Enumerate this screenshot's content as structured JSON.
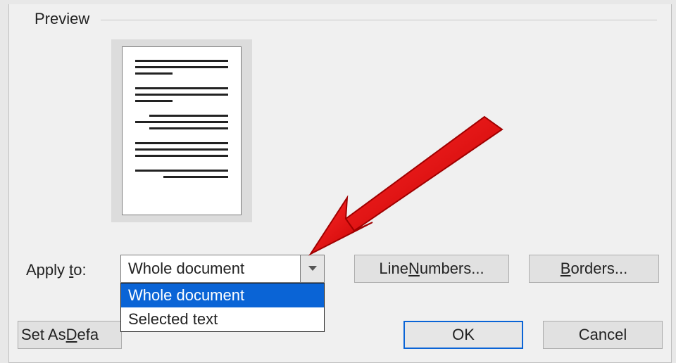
{
  "preview": {
    "group_label": "Preview"
  },
  "apply_to": {
    "label_prefix": "Apply ",
    "label_underlined": "t",
    "label_suffix": "o:",
    "selected": "Whole document",
    "options": [
      "Whole document",
      "Selected text"
    ]
  },
  "buttons": {
    "line_numbers_prefix": "Line ",
    "line_numbers_underlined": "N",
    "line_numbers_suffix": "umbers...",
    "borders_underlined": "B",
    "borders_suffix": "orders...",
    "set_default_prefix": "Set As ",
    "set_default_underlined": "D",
    "set_default_suffix": "efa",
    "ok": "OK",
    "cancel": "Cancel"
  },
  "annotation": {
    "arrow_color": "#E81123"
  }
}
